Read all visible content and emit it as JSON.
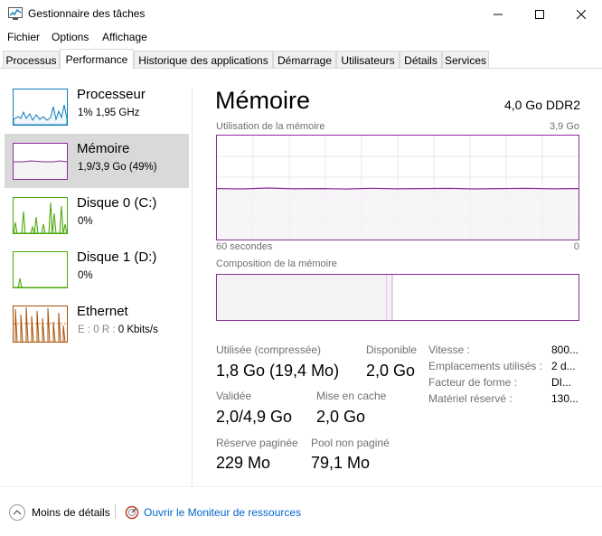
{
  "window": {
    "title": "Gestionnaire des tâches"
  },
  "menu": [
    {
      "label": "Fichier"
    },
    {
      "label": "Options"
    },
    {
      "label": "Affichage"
    }
  ],
  "tabs": [
    {
      "label": "Processus",
      "active": false
    },
    {
      "label": "Performance",
      "active": true
    },
    {
      "label": "Historique des applications",
      "active": false
    },
    {
      "label": "Démarrage",
      "active": false
    },
    {
      "label": "Utilisateurs",
      "active": false
    },
    {
      "label": "Détails",
      "active": false
    },
    {
      "label": "Services",
      "active": false
    }
  ],
  "sidebar": [
    {
      "name": "Processeur",
      "value": "1% 1,95 GHz",
      "color": "#117dbb",
      "selected": false
    },
    {
      "name": "Mémoire",
      "value": "1,9/3,9 Go (49%)",
      "color": "#8b2c9a",
      "selected": true
    },
    {
      "name": "Disque 0 (C:)",
      "value": "0%",
      "color": "#4da60c",
      "selected": false
    },
    {
      "name": "Disque 1 (D:)",
      "value": "0%",
      "color": "#4da60c",
      "selected": false
    },
    {
      "name": "Ethernet",
      "value_gray": "E : 0 R : ",
      "value": "0 Kbits/s",
      "color": "#a74f01",
      "selected": false
    }
  ],
  "memory": {
    "title": "Mémoire",
    "type_label": "4,0 Go DDR2",
    "usage_label": "Utilisation de la mémoire",
    "usage_max": "3,9 Go",
    "time_left": "60 secondes",
    "time_right": "0",
    "composition_label": "Composition de la mémoire",
    "usage_percent": 49,
    "in_use_fraction": 0.47,
    "modified_fraction": 0.015,
    "stats": {
      "used_label": "Utilisée (compressée)",
      "used_value": "1,8 Go (19,4 Mo)",
      "available_label": "Disponible",
      "available_value": "2,0 Go",
      "committed_label": "Validée",
      "committed_value": "2,0/4,9 Go",
      "cached_label": "Mise en cache",
      "cached_value": "2,0 Go",
      "paged_label": "Réserve paginée",
      "paged_value": "229 Mo",
      "nonpaged_label": "Pool non paginé",
      "nonpaged_value": "79,1 Mo"
    },
    "details": [
      {
        "label": "Vitesse :",
        "value": "800..."
      },
      {
        "label": "Emplacements utilisés :",
        "value": "2 d..."
      },
      {
        "label": "Facteur de forme :",
        "value": "DI..."
      },
      {
        "label": "Matériel réservé :",
        "value": "130..."
      }
    ]
  },
  "footer": {
    "fewer_details": "Moins de détails",
    "open_monitor": "Ouvrir le Moniteur de ressources"
  },
  "colors": {
    "memory_accent": "#8b2c9a",
    "memory_fill": "#f4f2f4",
    "link": "#0066cc"
  },
  "icons": {
    "app": "task-manager-icon",
    "minimize": "minimize-icon",
    "maximize": "maximize-icon",
    "close": "close-icon",
    "fewer_details": "chevron-up-icon",
    "resource_monitor": "resource-monitor-icon"
  }
}
